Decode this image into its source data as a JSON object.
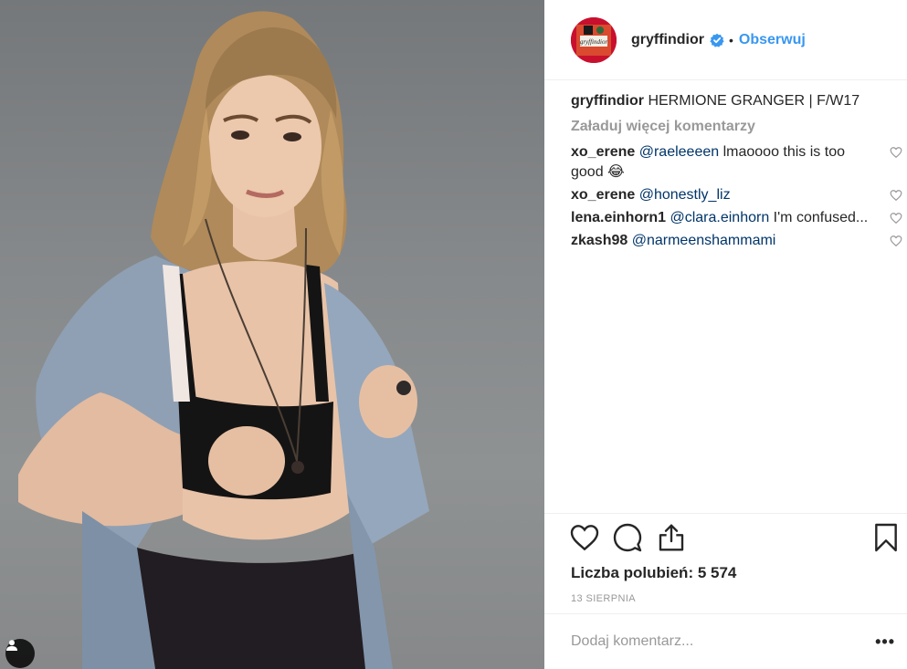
{
  "post": {
    "username": "gryffindior",
    "follow_label": "Obserwuj",
    "dot": "•",
    "avatar_text": "gryffindior",
    "caption": {
      "user": "gryffindior",
      "text": "HERMIONE GRANGER | F/W17"
    },
    "load_more": "Załaduj więcej komentarzy",
    "comments": [
      {
        "user": "xo_erene",
        "mention": "@raeleeeen",
        "text": " lmaoooo this is too good 😂"
      },
      {
        "user": "xo_erene",
        "mention": "@honestly_liz",
        "text": ""
      },
      {
        "user": "lena.einhorn1",
        "mention": "@clara.einhorn",
        "text": " I'm confused..."
      },
      {
        "user": "zkash98",
        "mention": "@narmeenshammami",
        "text": ""
      }
    ],
    "likes": "Liczba polubień: 5 574",
    "date": "13 SIERPNIA",
    "comment_placeholder": "Dodaj komentarz...",
    "more_label": "•••"
  },
  "icons": {
    "verified": "verified-badge-icon",
    "like": "heart-icon",
    "comment": "comment-bubble-icon",
    "share": "share-icon",
    "save": "bookmark-icon",
    "tag": "user-tag-icon"
  },
  "colors": {
    "link": "#3897f0",
    "mention": "#003569",
    "muted": "#999999"
  }
}
